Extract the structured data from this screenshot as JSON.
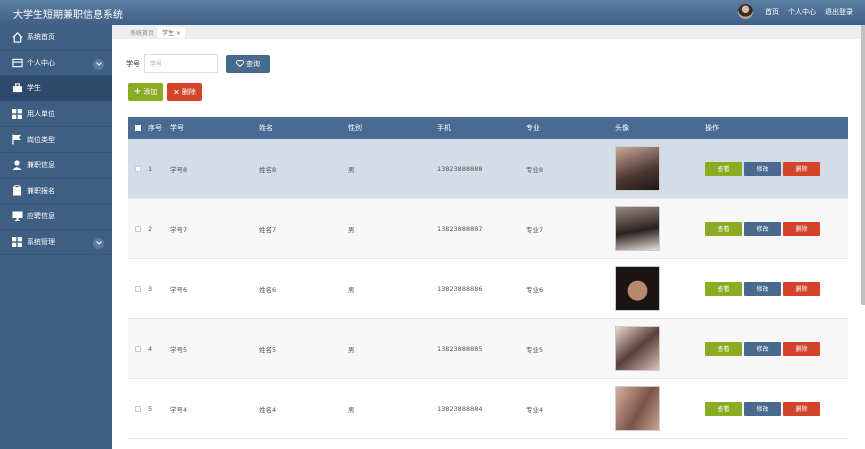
{
  "header": {
    "app_title": "大学生短期兼职信息系统",
    "links": [
      "首页",
      "个人中心",
      "退出登录"
    ]
  },
  "sidebar": {
    "items": [
      {
        "label": "系统首页",
        "icon": "home-icon"
      },
      {
        "label": "个人中心",
        "icon": "card-icon",
        "expand": true
      },
      {
        "label": "学生",
        "icon": "briefcase-icon",
        "active": true
      },
      {
        "label": "用人单位",
        "icon": "grid-icon"
      },
      {
        "label": "岗位类型",
        "icon": "flag-icon"
      },
      {
        "label": "兼职信息",
        "icon": "user-icon"
      },
      {
        "label": "兼职报名",
        "icon": "clipboard-icon"
      },
      {
        "label": "应聘信息",
        "icon": "monitor-icon"
      },
      {
        "label": "系统管理",
        "icon": "grid-icon",
        "expand": true
      }
    ]
  },
  "breadcrumb": {
    "home": "系统首页",
    "tab": "学生 ×"
  },
  "search": {
    "label": "学号",
    "placeholder": "学号",
    "button": "查询"
  },
  "toolbar": {
    "add": "添加",
    "delete": "删除"
  },
  "table": {
    "headers": [
      "序号",
      "学号",
      "姓名",
      "性别",
      "手机",
      "专业",
      "头像",
      "操作"
    ],
    "rows": [
      {
        "no": "1",
        "id": "学号8",
        "name": "姓名8",
        "sex": "男",
        "phone": "13823888888",
        "major": "专业8"
      },
      {
        "no": "2",
        "id": "学号7",
        "name": "姓名7",
        "sex": "男",
        "phone": "13823888887",
        "major": "专业7"
      },
      {
        "no": "3",
        "id": "学号6",
        "name": "姓名6",
        "sex": "男",
        "phone": "13823888886",
        "major": "专业6"
      },
      {
        "no": "4",
        "id": "学号5",
        "name": "姓名5",
        "sex": "男",
        "phone": "13823888885",
        "major": "专业5"
      },
      {
        "no": "5",
        "id": "学号4",
        "name": "姓名4",
        "sex": "男",
        "phone": "13823888884",
        "major": "专业4"
      }
    ],
    "row_actions": {
      "view": "查看",
      "edit": "修改",
      "delete": "删除"
    }
  },
  "colors": {
    "header": "#496b93",
    "sidebar": "#3f5f82",
    "green": "#8aab22",
    "red": "#d2432a"
  }
}
